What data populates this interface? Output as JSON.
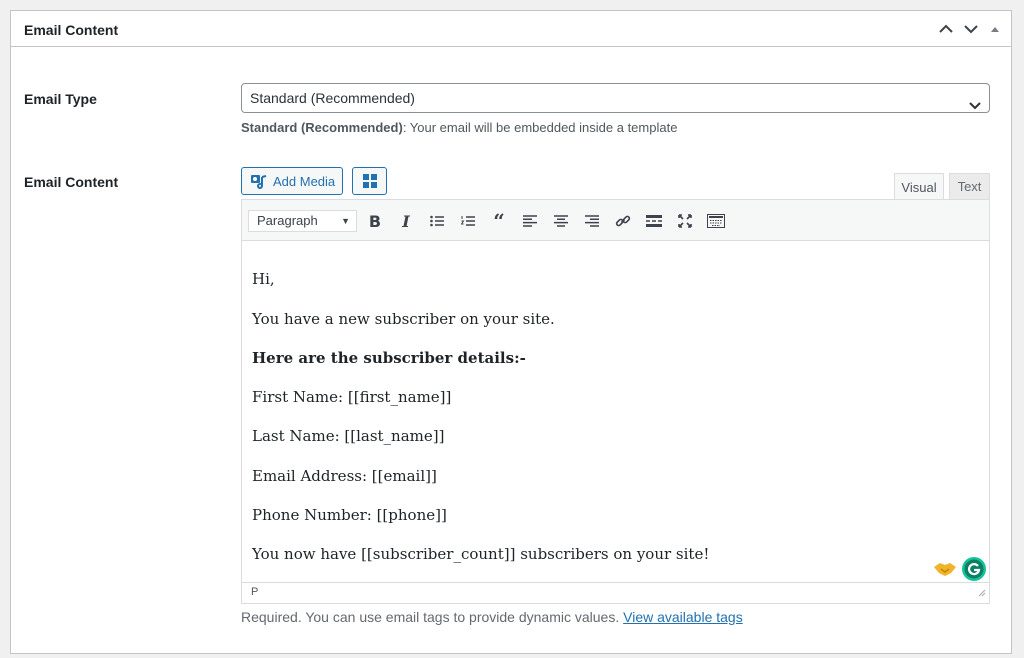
{
  "panel": {
    "title": "Email Content"
  },
  "email_type": {
    "label": "Email Type",
    "selected": "Standard (Recommended)",
    "description_bold": "Standard (Recommended)",
    "description_rest": ": Your email will be embedded inside a template"
  },
  "email_content": {
    "label": "Email Content",
    "add_media_label": "Add Media",
    "tabs": [
      "Visual",
      "Text"
    ],
    "format_select": "Paragraph",
    "toolbar_icons": [
      "bold-icon",
      "italic-icon",
      "bullet-list-icon",
      "numbered-list-icon",
      "blockquote-icon",
      "align-left-icon",
      "align-center-icon",
      "align-right-icon",
      "link-icon",
      "read-more-icon",
      "fullscreen-icon",
      "toolbar-toggle-icon"
    ],
    "lines": [
      "Hi,",
      "You have a new subscriber on your site.",
      "Here are the subscriber details:-",
      "First Name: [[first_name]]",
      "Last Name: [[last_name]]",
      "Email Address: [[email]]",
      "Phone Number: [[phone]]",
      "You now have [[subscriber_count]] subscribers on your site!"
    ],
    "status_path": "P"
  },
  "footer": {
    "note": "Required. You can use email tags to provide dynamic values.",
    "link": "View available tags"
  },
  "colors": {
    "accent": "#2271b1",
    "grammarly": "#15c39a"
  }
}
